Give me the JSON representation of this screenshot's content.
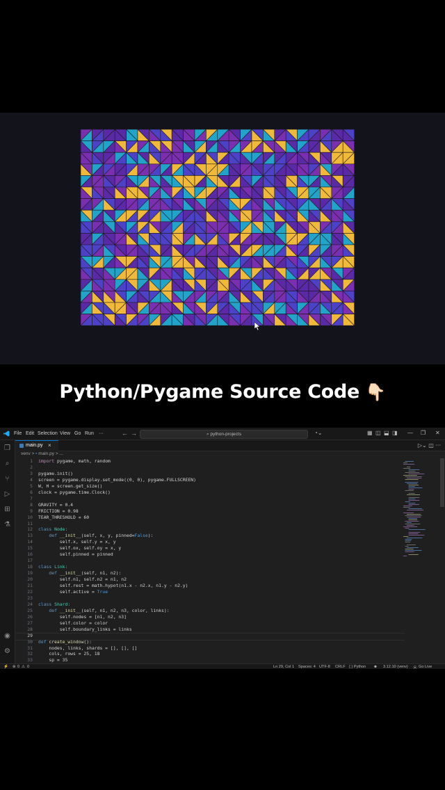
{
  "caption": {
    "text": "Python/Pygame Source Code",
    "emoji": "👇🏻"
  },
  "mosaic": {
    "cols": 24,
    "rows": 17,
    "colors": [
      "#f0b93a",
      "#22a3c9",
      "#4d42c7",
      "#5a2aa6",
      "#7a2fb0"
    ]
  },
  "menubar": {
    "items": [
      "File",
      "Edit",
      "Selection",
      "View",
      "Go",
      "Run",
      "···"
    ],
    "search": "python-projects"
  },
  "tab": {
    "label": "main.py",
    "close": "×"
  },
  "breadcrumb": {
    "folder": "venv",
    "sep": ">",
    "file": "main.py",
    "trail": "> ..."
  },
  "code_lines": [
    {
      "n": "1",
      "t": [
        [
          "kw",
          "import"
        ],
        [
          "p",
          " pygame, math, random"
        ]
      ]
    },
    {
      "n": "2",
      "t": []
    },
    {
      "n": "3",
      "t": [
        [
          "p",
          "pygame.init()"
        ]
      ]
    },
    {
      "n": "4",
      "t": [
        [
          "p",
          "screen = pygame.display.set_mode((0, 0), pygame.FULLSCREEN)"
        ]
      ]
    },
    {
      "n": "5",
      "t": [
        [
          "p",
          "W, H = screen.get_size()"
        ]
      ]
    },
    {
      "n": "6",
      "t": [
        [
          "p",
          "clock = pygame.time.Clock()"
        ]
      ]
    },
    {
      "n": "7",
      "t": []
    },
    {
      "n": "8",
      "t": [
        [
          "p",
          "GRAVITY = 0.4"
        ]
      ]
    },
    {
      "n": "9",
      "t": [
        [
          "p",
          "FRICTION = 0.98"
        ]
      ]
    },
    {
      "n": "10",
      "t": [
        [
          "p",
          "TEAR_THRESHOLD = 60"
        ]
      ]
    },
    {
      "n": "11",
      "t": []
    },
    {
      "n": "12",
      "t": [
        [
          "kw",
          "class"
        ],
        [
          "cls",
          " Node:"
        ]
      ]
    },
    {
      "n": "13",
      "t": [
        [
          "p",
          "    "
        ],
        [
          "kw",
          "def"
        ],
        [
          "fn",
          " __init__"
        ],
        [
          "p",
          "(self, x, y, pinned="
        ],
        [
          "kw",
          "False"
        ],
        [
          "p",
          "):"
        ]
      ]
    },
    {
      "n": "14",
      "t": [
        [
          "p",
          "        self.x, self.y = x, y"
        ]
      ]
    },
    {
      "n": "15",
      "t": [
        [
          "p",
          "        self.ox, self.oy = x, y"
        ]
      ]
    },
    {
      "n": "16",
      "t": [
        [
          "p",
          "        self.pinned = pinned"
        ]
      ]
    },
    {
      "n": "17",
      "t": []
    },
    {
      "n": "18",
      "t": [
        [
          "kw",
          "class"
        ],
        [
          "cls",
          " Link:"
        ]
      ]
    },
    {
      "n": "19",
      "t": [
        [
          "p",
          "    "
        ],
        [
          "kw",
          "def"
        ],
        [
          "fn",
          " __init__"
        ],
        [
          "p",
          "(self, n1, n2):"
        ]
      ]
    },
    {
      "n": "20",
      "t": [
        [
          "p",
          "        self.n1, self.n2 = n1, n2"
        ]
      ]
    },
    {
      "n": "21",
      "t": [
        [
          "p",
          "        self.rest = math.hypot(n1.x - n2.x, n1.y - n2.y)"
        ]
      ]
    },
    {
      "n": "22",
      "t": [
        [
          "p",
          "        self.active = "
        ],
        [
          "kw",
          "True"
        ]
      ]
    },
    {
      "n": "23",
      "t": []
    },
    {
      "n": "24",
      "t": [
        [
          "kw",
          "class"
        ],
        [
          "cls",
          " Shard:"
        ]
      ]
    },
    {
      "n": "25",
      "t": [
        [
          "p",
          "    "
        ],
        [
          "kw",
          "def"
        ],
        [
          "fn",
          " __init__"
        ],
        [
          "p",
          "(self, n1, n2, n3, color, links):"
        ]
      ]
    },
    {
      "n": "26",
      "t": [
        [
          "p",
          "        self.nodes = [n1, n2, n3]"
        ]
      ]
    },
    {
      "n": "27",
      "t": [
        [
          "p",
          "        self.color = color"
        ]
      ]
    },
    {
      "n": "28",
      "t": [
        [
          "p",
          "        self.boundary_links = links"
        ]
      ]
    },
    {
      "n": "29",
      "t": []
    },
    {
      "n": "30",
      "t": [
        [
          "kw",
          "def"
        ],
        [
          "fn",
          " create_window"
        ],
        [
          "p",
          "():"
        ]
      ]
    },
    {
      "n": "31",
      "t": [
        [
          "p",
          "    nodes, links, shards = [], [], []"
        ]
      ]
    },
    {
      "n": "32",
      "t": [
        [
          "p",
          "    cols, rows = 25, 18"
        ]
      ]
    },
    {
      "n": "33",
      "t": [
        [
          "p",
          "    sp = 35"
        ]
      ]
    }
  ],
  "current_line": "29",
  "status": {
    "position": "Ln 29, Col 1",
    "spaces": "Spaces: 4",
    "encoding": "UTF-8",
    "eol": "CRLF",
    "language": "{ } Python",
    "interpreter": "3.12.10 (venv)",
    "golive": "Go Live",
    "problems": "0",
    "warnings": "0"
  },
  "colors": {
    "keyword": "#c586c0",
    "decl": "#569cd6",
    "class_name": "#4ec9b0",
    "function": "#dcdcaa",
    "plain": "#d4d4d4"
  }
}
